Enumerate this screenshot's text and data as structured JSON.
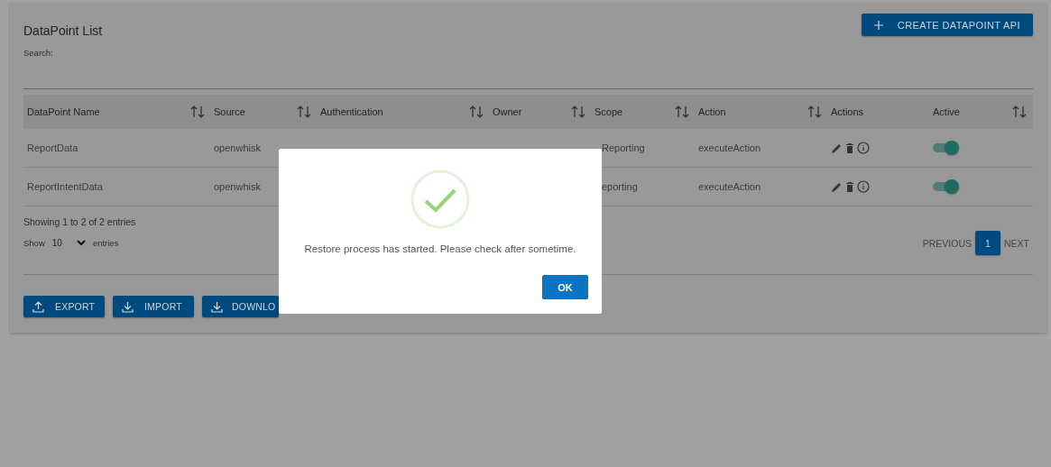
{
  "title": "DataPoint List",
  "search_label": "Search:",
  "create_button": "CREATE DATAPOINT API",
  "columns": [
    {
      "label": "DataPoint Name",
      "sortable": true
    },
    {
      "label": "Source",
      "sortable": true
    },
    {
      "label": "Authentication",
      "sortable": true
    },
    {
      "label": "Owner",
      "sortable": true
    },
    {
      "label": "Scope",
      "sortable": true
    },
    {
      "label": "Action",
      "sortable": true
    },
    {
      "label": "Actions",
      "sortable": false
    },
    {
      "label": "Active",
      "sortable": true
    }
  ],
  "rows": [
    {
      "name": "ReportData",
      "source": "openwhisk",
      "scope": "Reporting",
      "action": "executeAction",
      "active": true
    },
    {
      "name": "ReportIntentData",
      "source": "openwhisk",
      "scope": "eporting",
      "action": "executeAction",
      "active": true
    }
  ],
  "info": "Showing 1 to 2 of 2 entries",
  "page_length": {
    "label_before": "Show",
    "value": "10",
    "label_after": "entries"
  },
  "pagination": {
    "previous": "PREVIOUS",
    "pages": [
      {
        "label": "1",
        "selected": true
      }
    ],
    "next": "NEXT"
  },
  "buttons": [
    {
      "label": "EXPORT",
      "kind": "export"
    },
    {
      "label": "IMPORT",
      "kind": "import"
    },
    {
      "label": "DOWNLO",
      "kind": "download"
    }
  ],
  "dialog": {
    "message": "Restore process has started. Please check after sometime.",
    "button": "OK"
  }
}
